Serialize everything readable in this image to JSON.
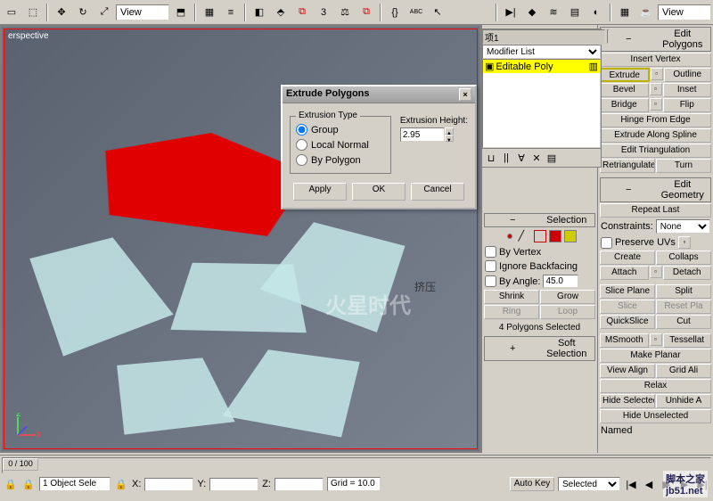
{
  "toolbar": {
    "view_dropdown": "View",
    "view_dropdown2": "View"
  },
  "viewport": {
    "label": "erspective"
  },
  "dialog": {
    "title": "Extrude Polygons",
    "groupbox": "Extrusion Type",
    "radio_group": "Group",
    "radio_local": "Local Normal",
    "radio_poly": "By Polygon",
    "height_label": "Extrusion Height:",
    "height_value": "2.95",
    "apply": "Apply",
    "ok": "OK",
    "cancel": "Cancel"
  },
  "modstack": {
    "name": "项1",
    "dropdown": "Modifier List",
    "item": "Editable Poly"
  },
  "selection": {
    "header": "Selection",
    "by_vertex": "By Vertex",
    "ignore_backfacing": "Ignore Backfacing",
    "by_angle": "By Angle:",
    "angle_value": "45.0",
    "shrink": "Shrink",
    "grow": "Grow",
    "ring": "Ring",
    "loop": "Loop",
    "status": "4 Polygons Selected"
  },
  "soft_selection": {
    "header": "Soft Selection"
  },
  "edit_polygons": {
    "header": "Edit Polygons",
    "insert_vertex": "Insert Vertex",
    "extrude": "Extrude",
    "outline": "Outline",
    "bevel": "Bevel",
    "inset": "Inset",
    "bridge": "Bridge",
    "flip": "Flip",
    "hinge": "Hinge From Edge",
    "extrude_spline": "Extrude Along Spline",
    "edit_tri": "Edit Triangulation",
    "retriangulate": "Retriangulate",
    "turn": "Turn"
  },
  "edit_geometry": {
    "header": "Edit Geometry",
    "repeat_last": "Repeat Last",
    "constraints": "Constraints:",
    "constraints_value": "None",
    "preserve_uvs": "Preserve UVs",
    "create": "Create",
    "collapse": "Collaps",
    "attach": "Attach",
    "detach": "Detach",
    "slice_plane": "Slice Plane",
    "split": "Split",
    "slice": "Slice",
    "reset_plane": "Reset Pla",
    "quickslice": "QuickSlice",
    "cut": "Cut",
    "msmooth": "MSmooth",
    "tessellate": "Tessellat",
    "make_planar": "Make Planar",
    "view_align": "View Align",
    "grid_align": "Grid Ali",
    "relax": "Relax",
    "hide_selected": "Hide Selected",
    "unhide": "Unhide A",
    "hide_unselected": "Hide Unselected",
    "named": "Named"
  },
  "chinese": {
    "label": "挤压",
    "watermark": "火星时代",
    "footer": "脚本之家"
  },
  "status": {
    "timeline": "0 / 100",
    "objects": "1 Object Sele",
    "x": "X:",
    "y": "Y:",
    "z": "Z:",
    "grid": "Grid = 10.0",
    "autokey": "Auto Key",
    "selected": "Selected"
  },
  "footer": "jb51.net"
}
